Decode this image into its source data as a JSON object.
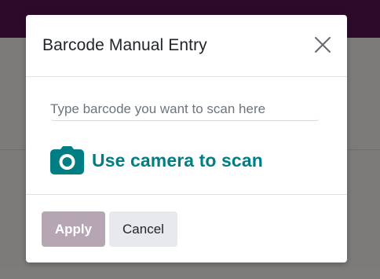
{
  "dialog": {
    "title": "Barcode Manual Entry",
    "close_icon": "close-icon"
  },
  "body": {
    "input_value": "",
    "input_placeholder": "Type barcode you want to scan here",
    "camera_icon": "camera-icon",
    "camera_label": "Use camera to scan"
  },
  "footer": {
    "apply_label": "Apply",
    "cancel_label": "Cancel"
  },
  "colors": {
    "accent": "#017e84",
    "primary_disabled": "#b6a5b3",
    "secondary_bg": "#e7e9ed",
    "topbar": "#2e0a2a",
    "overlay": "#7c7b7a"
  }
}
